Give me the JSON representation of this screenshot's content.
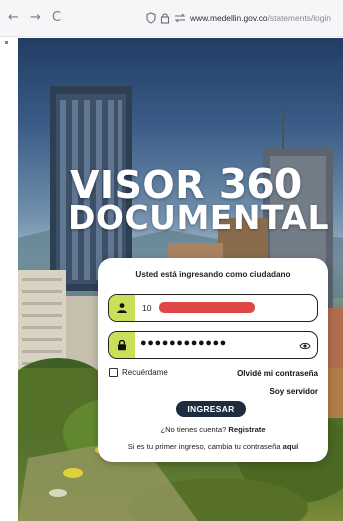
{
  "browser": {
    "back_icon": "←",
    "forward_icon": "→",
    "reload_icon": "C",
    "url_domain": "www.medellin.gov.co",
    "url_path": "/statements/login"
  },
  "hero": {
    "title_line1_word": "VISOR",
    "title_line1_number": "360",
    "title_line2": "DOCUMENTAL"
  },
  "login": {
    "heading": "Usted está ingresando como ciudadano",
    "username_prefix": "10",
    "password_mask": "●●●●●●●●●●●●",
    "remember_label": "Recuérdame",
    "forgot_link": "Olvidé mi contraseña",
    "servidor_link": "Soy servidor",
    "submit_label": "INGRESAR",
    "no_account_text": "¿No tienes cuenta?",
    "register_link": "Registrate",
    "first_login_text": "Si es tu primer ingreso, cambia tu contraseña",
    "first_login_link": "aquí"
  },
  "colors": {
    "field_icon_bg": "#cbe05a",
    "button_bg": "#1d2d3d",
    "redaction": "#e04848"
  }
}
